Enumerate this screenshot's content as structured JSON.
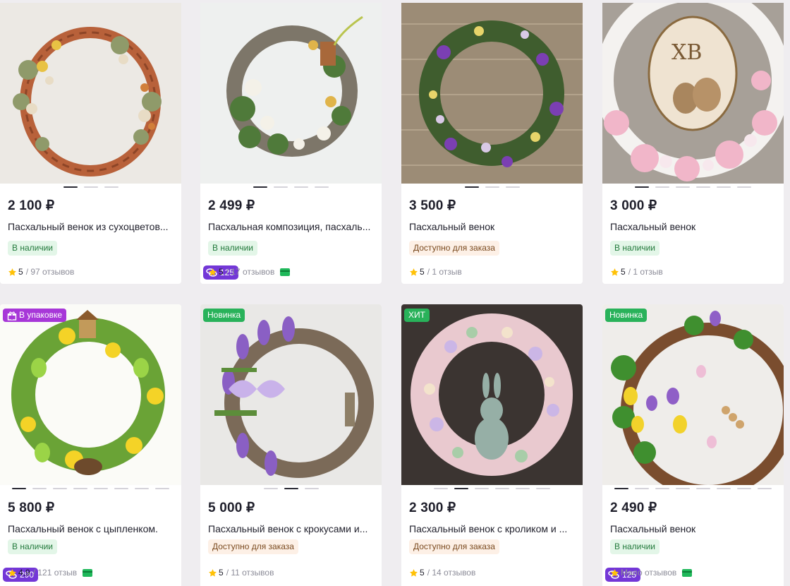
{
  "products": [
    {
      "price": "2 100 ₽",
      "title": "Пасхальный венок из сухоцветов...",
      "stock": "В наличии",
      "rating": "5",
      "reviews": "/ 97 отзывов",
      "dots": 3,
      "active_dot": 0
    },
    {
      "price": "2 499 ₽",
      "title": "Пасхальная композиция, пасхаль...",
      "stock": "В наличии",
      "rating": "5",
      "reviews": "/ 17 отзывов",
      "bonus": "125",
      "dots": 4,
      "active_dot": 0
    },
    {
      "price": "3 500 ₽",
      "title": "Пасхальный венок",
      "stock": "Доступно для заказа",
      "rating": "5",
      "reviews": "/ 1 отзыв",
      "dots": 3,
      "active_dot": 0
    },
    {
      "price": "3 000 ₽",
      "title": "Пасхальный венок",
      "stock": "В наличии",
      "rating": "5",
      "reviews": "/ 1 отзыв",
      "image_text": "ХВ",
      "dots": 6,
      "active_dot": 0
    },
    {
      "price": "5 800 ₽",
      "title": "Пасхальный венок с цыпленком.",
      "stock": "В наличии",
      "rating": "4,9",
      "reviews": "/ 121 отзыв",
      "promo": "В упаковке",
      "bonus": "290",
      "dots": 8,
      "active_dot": 0
    },
    {
      "price": "5 000 ₽",
      "title": "Пасхальный венок с крокусами и...",
      "stock": "Доступно для заказа",
      "rating": "5",
      "reviews": "/ 11 отзывов",
      "promo": "Новинка",
      "dots": 3,
      "active_dot": 1
    },
    {
      "price": "2 300 ₽",
      "title": "Пасхальный венок с кроликом и ...",
      "stock": "Доступно для заказа",
      "rating": "5",
      "reviews": "/ 14 отзывов",
      "promo": "ХИТ",
      "dots": 6,
      "active_dot": 1
    },
    {
      "price": "2 490 ₽",
      "title": "Пасхальный венок",
      "stock": "В наличии",
      "rating": "",
      "reviews": "Мало отзывов",
      "promo": "Новинка",
      "bonus": "125",
      "dots": 8,
      "active_dot": 0
    }
  ],
  "colors": {
    "in_stock_bg": "#e3f6e8",
    "order_bg": "#fdf0e6",
    "promo_green": "#29b25a",
    "promo_purple": "#a737d8",
    "bonus_purple": "#7337d7",
    "star": "#ffc107",
    "card_icon": "#1fb85a"
  },
  "icons": {
    "rating": "star-icon",
    "payment": "card-icon",
    "bonus": "coins-icon",
    "gift": "gift-icon"
  }
}
